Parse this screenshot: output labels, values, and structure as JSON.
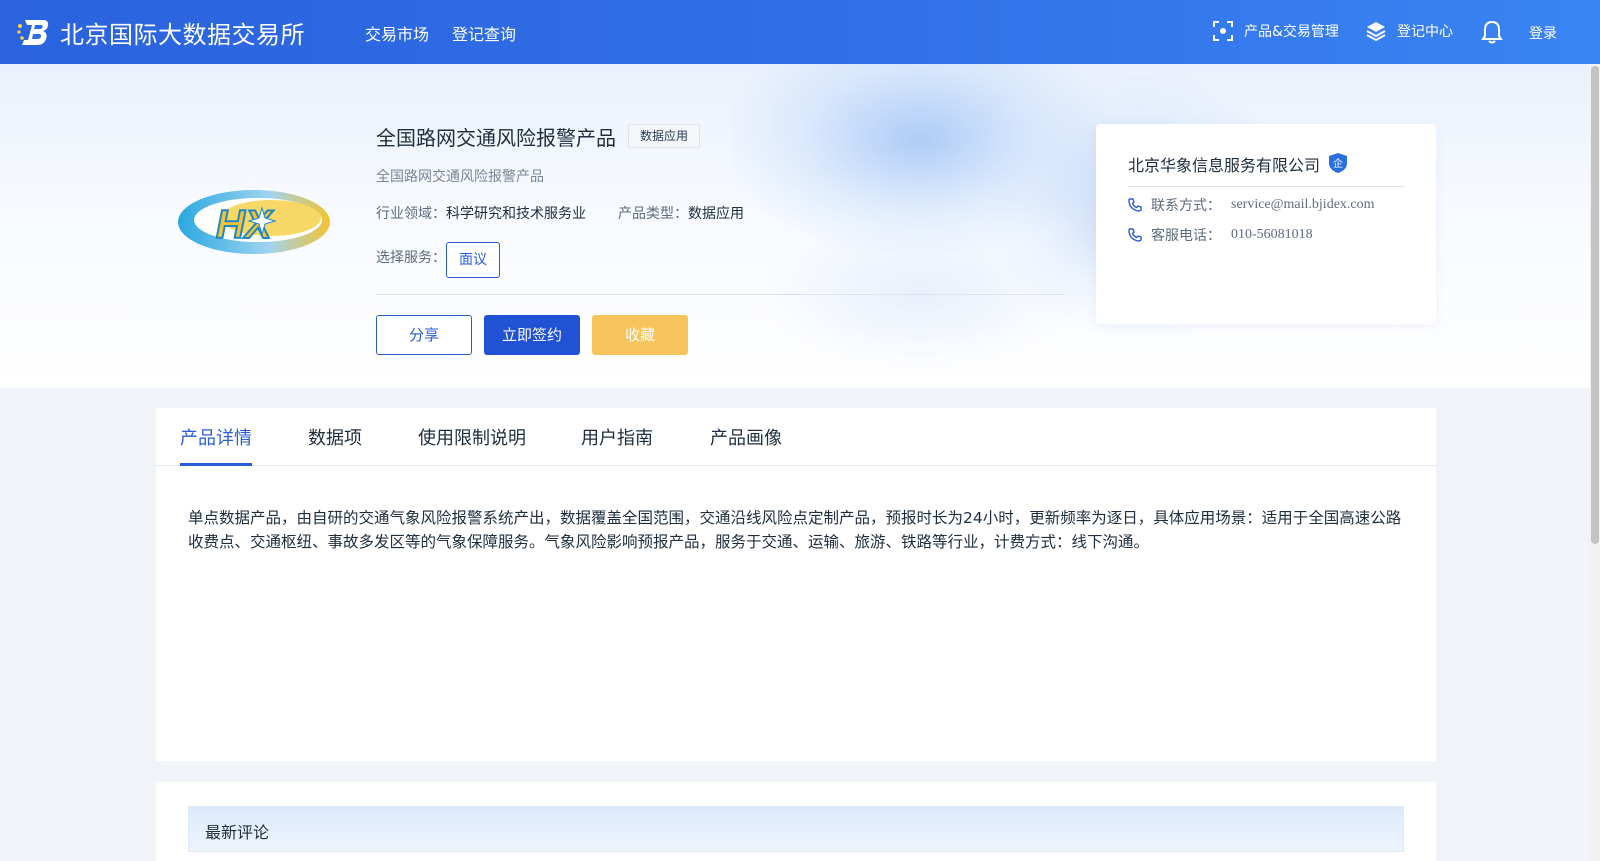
{
  "app": {
    "site_name": "北京国际大数据交易所"
  },
  "nav": {
    "links": [
      "交易市场",
      "登记查询"
    ],
    "product_mgmt": "产品&交易管理",
    "register_center": "登记中心",
    "login": "登录"
  },
  "product": {
    "title": "全国路网交通风险报警产品",
    "tag": "数据应用",
    "subtitle": "全国路网交通风险报警产品",
    "industry_label": "行业领域：",
    "industry_value": "科学研究和技术服务业",
    "type_label": "产品类型：",
    "type_value": "数据应用",
    "service_label": "选择服务：",
    "service_option": "面议",
    "logo_text": "HX",
    "buttons": {
      "share": "分享",
      "sign": "立即签约",
      "favorite": "收藏"
    }
  },
  "company": {
    "name": "北京华象信息服务有限公司",
    "badge": "企",
    "contact_label": "联系方式：",
    "contact_value": "service@mail.bjidex.com",
    "phone_label": "客服电话：",
    "phone_value": "010-56081018"
  },
  "tabs": {
    "items": [
      "产品详情",
      "数据项",
      "使用限制说明",
      "用户指南",
      "产品画像"
    ],
    "active": "产品详情"
  },
  "detail": {
    "text": "单点数据产品，由自研的交通气象风险报警系统产出，数据覆盖全国范围，交通沿线风险点定制产品，预报时长为24小时，更新频率为逐日，具体应用场景：适用于全国高速公路收费点、交通枢纽、事故多发区等的气象保障服务。气象风险影响预报产品，服务于交通、运输、旅游、铁路等行业，计费方式：线下沟通。"
  },
  "comments": {
    "title": "最新评论"
  },
  "colors": {
    "brand_blue": "#2a5cd9",
    "nav_gradient_start": "#2a63dd",
    "nav_gradient_end": "#3a84f2",
    "favorite_yellow": "#f6c35c"
  }
}
